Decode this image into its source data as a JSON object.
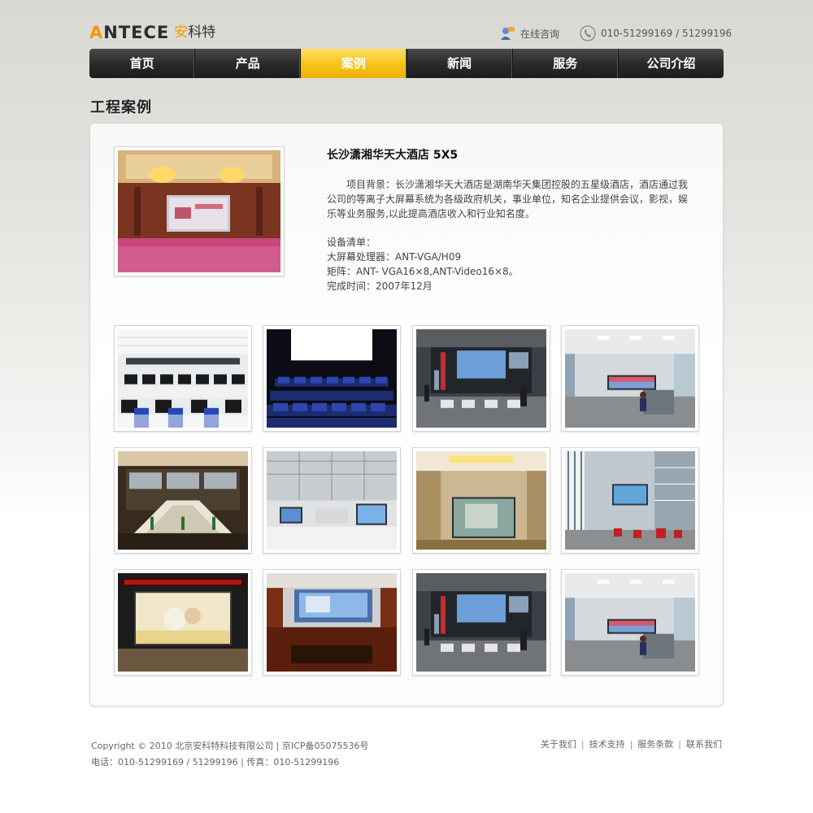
{
  "header": {
    "logo_en_a": "A",
    "logo_en_rest": "NTECE",
    "logo_cn_an": "安",
    "logo_cn_rest": "科特",
    "consult_label": "在线咨询",
    "phone": "010-51299169 / 51299196"
  },
  "nav": {
    "items": [
      {
        "label": "首页"
      },
      {
        "label": "产品"
      },
      {
        "label": "案例"
      },
      {
        "label": "新闻"
      },
      {
        "label": "服务"
      },
      {
        "label": "公司介绍"
      }
    ],
    "active_index": 2
  },
  "section_title": "工程案例",
  "project": {
    "title": "长沙潇湘华天大酒店 5X5",
    "description": "项目背景：长沙潇湘华天大酒店是湖南华天集团控股的五星级酒店，酒店通过我公司的等离子大屏幕系统为各级政府机关，事业单位，知名企业提供会议，影视，娱乐等业务服务,以此提高酒店收入和行业知名度。",
    "equipment_heading": "设备清单：",
    "equipment_lines": [
      "大屏幕处理器：ANT-VGA/H09",
      "矩阵：ANT- VGA16×8,ANT-Video16×8。",
      "完成时间：2007年12月"
    ]
  },
  "gallery": [
    "computer-classroom",
    "auditorium-seats",
    "control-room",
    "monitoring-hall",
    "conference-room",
    "exhibition-hall",
    "video-wall-lobby",
    "control-center",
    "banner-video-wall",
    "meeting-video-wall",
    "control-room",
    "monitoring-hall"
  ],
  "footer": {
    "copyright": "Copyright © 2010 北京安科特科技有限公司 | 京ICP备05075536号",
    "contact": "电话：010-51299169 / 51299196 | 传真：010-51299196",
    "links": [
      "关于我们",
      "技术支持",
      "服务条款",
      "联系我们"
    ]
  },
  "colors": {
    "accent": "#f39800",
    "nav_dark": "#2b2b2b",
    "nav_active": "#f7c51d"
  }
}
